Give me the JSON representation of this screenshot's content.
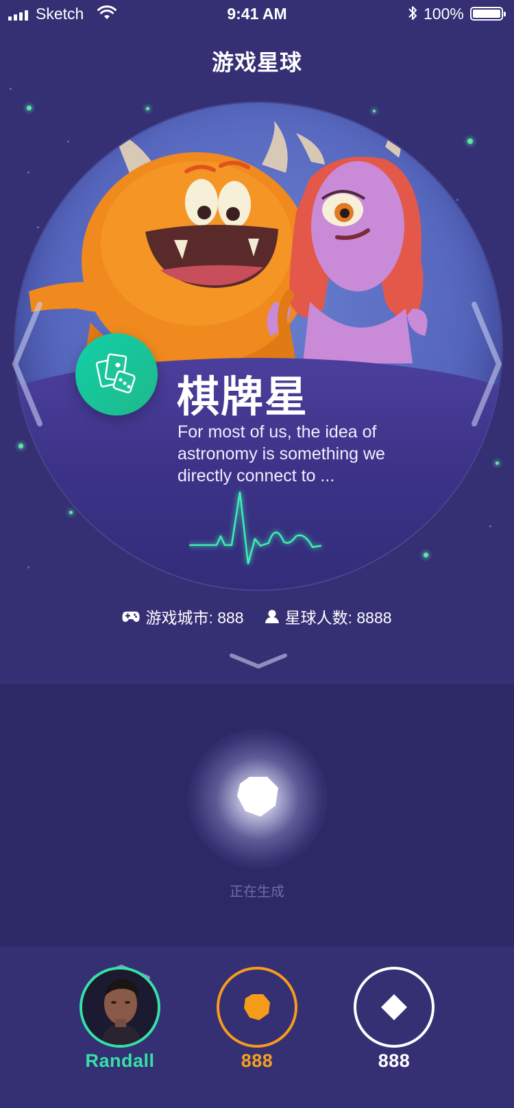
{
  "status_bar": {
    "carrier": "Sketch",
    "time": "9:41 AM",
    "battery": "100%"
  },
  "nav": {
    "title": "游戏星球"
  },
  "planet": {
    "name": "棋牌星",
    "description": "For most of us, the idea of astronomy is something we directly connect to ...",
    "badge_icon": "cards-dice-icon",
    "prev_arrow": "chevron-left-icon",
    "next_arrow": "chevron-right-icon"
  },
  "stats": {
    "cities": "游戏城市: 888",
    "population": "星球人数: 8888"
  },
  "generator": {
    "status": "正在生成"
  },
  "bottom_bar": {
    "user_name": "Randall",
    "coins": "888",
    "diamonds": "888"
  },
  "colors": {
    "background": "#352f74",
    "panel": "#2d2966",
    "accent_green": "#35e2a4",
    "accent_orange": "#f59c1a",
    "badge_gradient_start": "#12cfa7",
    "badge_gradient_end": "#1fb98a"
  }
}
